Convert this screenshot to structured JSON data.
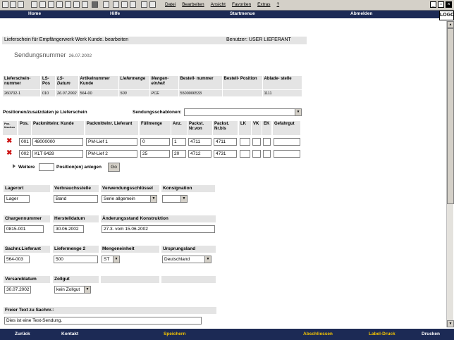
{
  "browser": {
    "menu": [
      "Datei",
      "Bearbeiten",
      "Ansicht",
      "Favoriten",
      "Extras",
      "?"
    ],
    "logo": "LOGO"
  },
  "topnav": {
    "home": "Home",
    "hilfe": "Hilfe",
    "startmenue": "Startmenue",
    "abmelden": "Abmelden"
  },
  "header": {
    "title": "Lieferschein für Empfängerwerk  Werk Kunde.  bearbeiten",
    "user": "Benutzer: USER LIEFERANT",
    "sendung_label": "Sendungsnummer",
    "sendung_date": "26.07.2002"
  },
  "summary": {
    "headers": [
      "Lieferschein-nummer",
      "LS-Pos",
      "LS-Datum",
      "Artikelnummer Kunde",
      "Liefermenge",
      "Mengen-einheit",
      "Bestell- nummer",
      "Bestell- Position",
      "Ablade- stelle"
    ],
    "row": [
      "260702-1",
      "010",
      "26.07.2002",
      "564-00",
      "500",
      "PCE",
      "5500006533",
      "",
      "1111"
    ]
  },
  "positions": {
    "label": "Positionen/zusatzdaten je Lieferschein",
    "schablonen_label": "Sendungsschablonen:",
    "schablonen_value": "",
    "headers": [
      "Pos. löschen",
      "Pos.",
      "Packmittelnr. Kunde",
      "Packmittelnr. Lieferant",
      "Füllmenge",
      "Anz.",
      "Packst. Nr.von",
      "Packst. Nr.bis",
      "LK",
      "VK",
      "EK",
      "Gefahrgut"
    ],
    "rows": [
      {
        "pos": "001",
        "kunde": "48000000",
        "lieferant": "PM-Lief 1",
        "fuellmenge": "0",
        "anz": "1",
        "von": "4711",
        "bis": "4711"
      },
      {
        "pos": "002",
        "kunde": "KLT 6428",
        "lieferant": "PM-Lief 2",
        "fuellmenge": "25",
        "anz": "20",
        "von": "4712",
        "bis": "4731"
      }
    ],
    "weitere": "Weitere",
    "anlegen": "Position(en) anlegen",
    "go": "Go"
  },
  "form": {
    "lagerort_label": "Lagerort",
    "lagerort": "Lager",
    "verbrauch_label": "Verbrauchsstelle",
    "verbrauch": "Band",
    "verwendung_label": "Verwendungsschlüssel",
    "verwendung": "Serie allgemein",
    "konsignation_label": "Konsignation",
    "konsignation": "",
    "charge_label": "Chargennummer",
    "charge": "0815-001",
    "herstell_label": "Herstelldatum",
    "herstell": "30.06.2002",
    "aenderung_label": "Änderungsstand Konstruktion",
    "aenderung": "27.3. vom 15.06.2002",
    "sachnr_label": "Sachnr.Lieferant",
    "sachnr": "564-003",
    "liefermenge2_label": "Liefermenge 2",
    "liefermenge2": "500",
    "mengeneinheit_label": "Mengeneinheit",
    "mengeneinheit": "ST",
    "ursprung_label": "Ursprungsland",
    "ursprung": "Deutschland",
    "versand_label": "Versanddatum",
    "versand": "30.07.2002",
    "zollgut_label": "Zollgut",
    "zollgut": "kein Zollgut",
    "freitext_label": "Freier Text zu Sachnr.:",
    "freitext": "Dies ist eine Test-Sendung."
  },
  "bottomnav": {
    "zurueck": "Zurück",
    "kontakt": "Kontakt",
    "speichern": "Speichern",
    "abschliessen": "Abschliessen",
    "labeldruck": "Label-Druck",
    "drucken": "Drucken"
  },
  "colors": {
    "nav": "#1c2a55",
    "active": "#f5c400",
    "label_bg": "#e4e4e4",
    "delete": "#cc1111"
  }
}
